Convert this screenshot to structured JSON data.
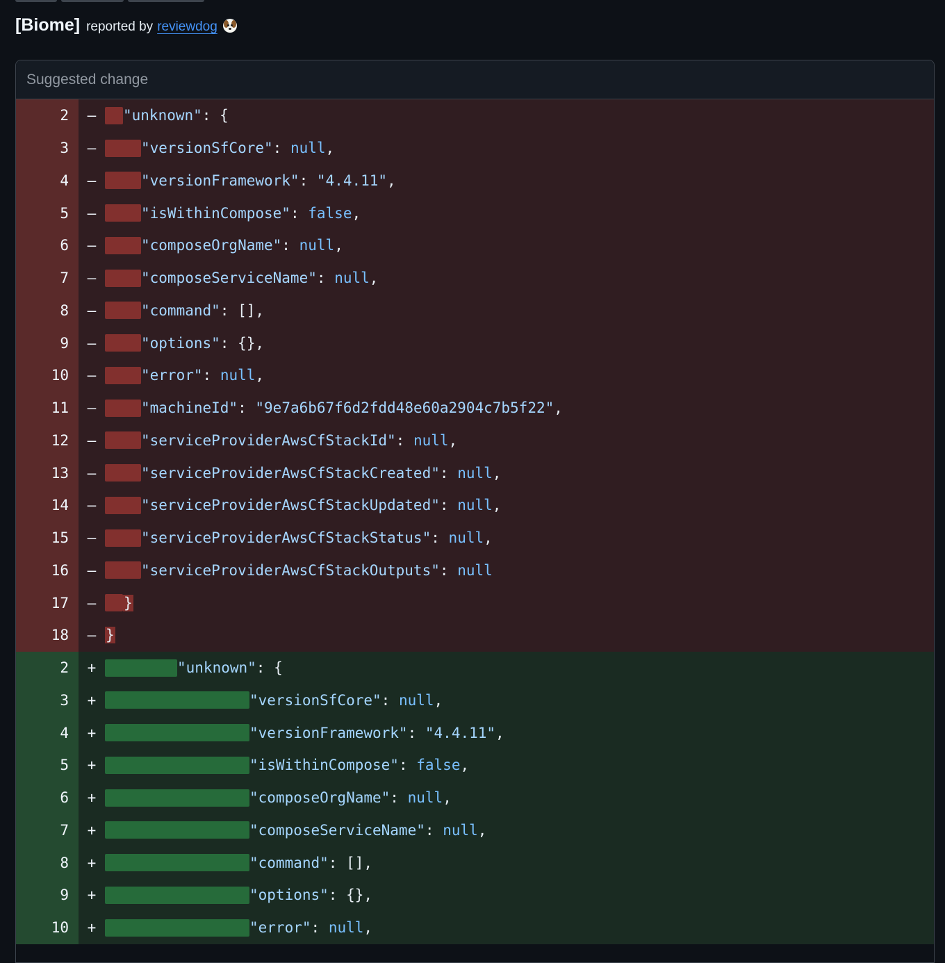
{
  "header": {
    "title": "[Biome]",
    "reported_by": "reported by",
    "reporter": "reviewdog"
  },
  "panel": {
    "title": "Suggested change"
  },
  "diff": {
    "removed": [
      {
        "ln": "2",
        "sign": "–",
        "text": "\"unknown\": {"
      },
      {
        "ln": "3",
        "sign": "–",
        "text": "\"versionSfCore\": null,"
      },
      {
        "ln": "4",
        "sign": "–",
        "text": "\"versionFramework\": \"4.4.11\","
      },
      {
        "ln": "5",
        "sign": "–",
        "text": "\"isWithinCompose\": false,"
      },
      {
        "ln": "6",
        "sign": "–",
        "text": "\"composeOrgName\": null,"
      },
      {
        "ln": "7",
        "sign": "–",
        "text": "\"composeServiceName\": null,"
      },
      {
        "ln": "8",
        "sign": "–",
        "text": "\"command\": [],"
      },
      {
        "ln": "9",
        "sign": "–",
        "text": "\"options\": {},"
      },
      {
        "ln": "10",
        "sign": "–",
        "text": "\"error\": null,"
      },
      {
        "ln": "11",
        "sign": "–",
        "text": "\"machineId\": \"9e7a6b67f6d2fdd48e60a2904c7b5f22\","
      },
      {
        "ln": "12",
        "sign": "–",
        "text": "\"serviceProviderAwsCfStackId\": null,"
      },
      {
        "ln": "13",
        "sign": "–",
        "text": "\"serviceProviderAwsCfStackCreated\": null,"
      },
      {
        "ln": "14",
        "sign": "–",
        "text": "\"serviceProviderAwsCfStackUpdated\": null,"
      },
      {
        "ln": "15",
        "sign": "–",
        "text": "\"serviceProviderAwsCfStackStatus\": null,"
      },
      {
        "ln": "16",
        "sign": "–",
        "text": "\"serviceProviderAwsCfStackOutputs\": null"
      },
      {
        "ln": "17",
        "sign": "–",
        "text": "}"
      },
      {
        "ln": "18",
        "sign": "–",
        "text": "}"
      }
    ],
    "added": [
      {
        "ln": "2",
        "sign": "+",
        "text": "\"unknown\": {"
      },
      {
        "ln": "3",
        "sign": "+",
        "text": "\"versionSfCore\": null,"
      },
      {
        "ln": "4",
        "sign": "+",
        "text": "\"versionFramework\": \"4.4.11\","
      },
      {
        "ln": "5",
        "sign": "+",
        "text": "\"isWithinCompose\": false,"
      },
      {
        "ln": "6",
        "sign": "+",
        "text": "\"composeOrgName\": null,"
      },
      {
        "ln": "7",
        "sign": "+",
        "text": "\"composeServiceName\": null,"
      },
      {
        "ln": "8",
        "sign": "+",
        "text": "\"command\": [],"
      },
      {
        "ln": "9",
        "sign": "+",
        "text": "\"options\": {},"
      },
      {
        "ln": "10",
        "sign": "+",
        "text": "\"error\": null,"
      }
    ]
  }
}
